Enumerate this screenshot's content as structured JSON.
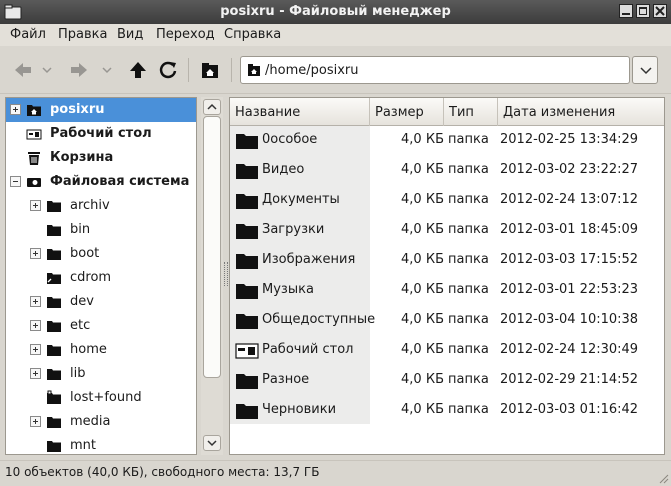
{
  "window": {
    "title": "posixru - Файловый менеджер"
  },
  "menu": [
    "Файл",
    "Правка",
    "Вид",
    "Переход",
    "Справка"
  ],
  "location": {
    "path": "/home/posixru"
  },
  "sidebar": {
    "items": [
      {
        "label": "posixru",
        "icon": "home-folder-icon",
        "expander": "plus",
        "selected": true,
        "bold": true,
        "indent": 0
      },
      {
        "label": "Рабочий стол",
        "icon": "desktop-icon",
        "bold": true,
        "indent": 0
      },
      {
        "label": "Корзина",
        "icon": "trash-icon",
        "bold": true,
        "indent": 0
      },
      {
        "label": "Файловая система",
        "icon": "drive-icon",
        "expander": "minus",
        "bold": true,
        "indent": 0
      },
      {
        "label": "archiv",
        "icon": "folder-icon",
        "expander": "plus",
        "indent": 1
      },
      {
        "label": "bin",
        "icon": "folder-icon",
        "indent": 1
      },
      {
        "label": "boot",
        "icon": "folder-icon",
        "expander": "plus",
        "indent": 1
      },
      {
        "label": "cdrom",
        "icon": "folder-link-icon",
        "indent": 1
      },
      {
        "label": "dev",
        "icon": "folder-icon",
        "expander": "plus",
        "indent": 1
      },
      {
        "label": "etc",
        "icon": "folder-icon",
        "expander": "plus",
        "indent": 1
      },
      {
        "label": "home",
        "icon": "folder-icon",
        "expander": "plus",
        "indent": 1
      },
      {
        "label": "lib",
        "icon": "folder-icon",
        "expander": "plus",
        "indent": 1
      },
      {
        "label": "lost+found",
        "icon": "folder-locked-icon",
        "indent": 1
      },
      {
        "label": "media",
        "icon": "folder-icon",
        "expander": "plus",
        "indent": 1
      },
      {
        "label": "mnt",
        "icon": "folder-icon",
        "indent": 1
      }
    ]
  },
  "files": {
    "columns": [
      "Название",
      "Размер",
      "Тип",
      "Дата изменения"
    ],
    "rows": [
      {
        "name": "0особое",
        "size": "4,0 КБ",
        "type": "папка",
        "date": "2012-02-25 13:34:29",
        "icon": "folder-icon"
      },
      {
        "name": "Видео",
        "size": "4,0 КБ",
        "type": "папка",
        "date": "2012-03-02 23:22:27",
        "icon": "folder-icon"
      },
      {
        "name": "Документы",
        "size": "4,0 КБ",
        "type": "папка",
        "date": "2012-02-24 13:07:12",
        "icon": "folder-icon"
      },
      {
        "name": "Загрузки",
        "size": "4,0 КБ",
        "type": "папка",
        "date": "2012-03-01 18:45:09",
        "icon": "folder-icon"
      },
      {
        "name": "Изображения",
        "size": "4,0 КБ",
        "type": "папка",
        "date": "2012-03-03 17:15:52",
        "icon": "folder-icon"
      },
      {
        "name": "Музыка",
        "size": "4,0 КБ",
        "type": "папка",
        "date": "2012-03-01 22:53:23",
        "icon": "folder-icon"
      },
      {
        "name": "Общедоступные",
        "size": "4,0 КБ",
        "type": "папка",
        "date": "2012-03-04 10:10:38",
        "icon": "folder-icon"
      },
      {
        "name": "Рабочий стол",
        "size": "4,0 КБ",
        "type": "папка",
        "date": "2012-02-24 12:30:49",
        "icon": "desktop-icon"
      },
      {
        "name": "Разное",
        "size": "4,0 КБ",
        "type": "папка",
        "date": "2012-02-29 21:14:52",
        "icon": "folder-icon"
      },
      {
        "name": "Черновики",
        "size": "4,0 КБ",
        "type": "папка",
        "date": "2012-03-03 01:16:42",
        "icon": "folder-icon"
      }
    ]
  },
  "status": {
    "text": "10 объектов (40,0 КБ), свободного места: 13,7 ГБ"
  }
}
